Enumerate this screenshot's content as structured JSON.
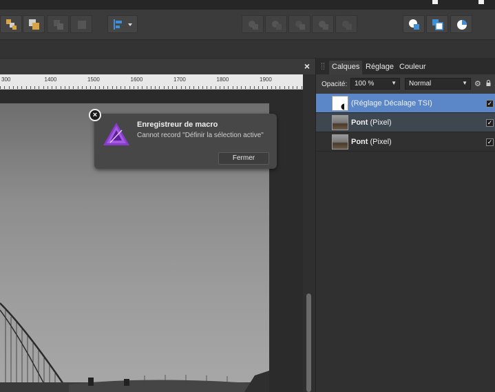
{
  "document": {
    "close_glyph": "×",
    "ruler_labels": [
      "300",
      "1400",
      "1500",
      "1600",
      "1700",
      "1800",
      "1900"
    ]
  },
  "notification": {
    "title": "Enregistreur de macro",
    "message": "Cannot record \"Définir la sélection active\"",
    "button_label": "Fermer",
    "close_glyph": "×"
  },
  "panel": {
    "tabs": [
      {
        "label": "Calques",
        "active": true
      },
      {
        "label": "Réglage",
        "active": false
      },
      {
        "label": "Couleur",
        "active": false
      }
    ],
    "opacity_label": "Opacité:",
    "opacity_value": "100 %",
    "blend_mode": "Normal",
    "layers": [
      {
        "name": "(Réglage Décalage TSI)",
        "type": "",
        "selected": true,
        "checked": true
      },
      {
        "name": "Pont",
        "type": "(Pixel)",
        "selected": false,
        "checked": true
      },
      {
        "name": "Pont",
        "type": "(Pixel)",
        "selected": false,
        "checked": true
      }
    ]
  },
  "colors": {
    "selected_layer": "#5b87c9",
    "hover_layer": "#3e4650",
    "accent_blue": "#3f8fd8",
    "affinity_purple": "#8a3ccf"
  },
  "icons": {
    "toolbar": [
      "arrange-back-icon",
      "arrange-forward-icon",
      "arrange-bottom-icon",
      "arrange-top-icon",
      "align-left-icon",
      "boolean-add-icon",
      "boolean-subtract-icon",
      "boolean-intersect-icon",
      "boolean-xor-icon",
      "boolean-divide-icon",
      "insert-front-icon",
      "insert-back-icon",
      "pie-icon"
    ]
  }
}
